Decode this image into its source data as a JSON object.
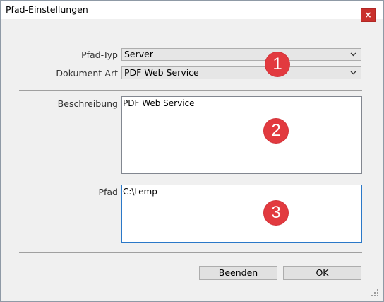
{
  "window": {
    "title": "Pfad-Einstellungen",
    "close_glyph": "×"
  },
  "form": {
    "pfad_typ": {
      "label": "Pfad-Typ",
      "value": "Server"
    },
    "dokument_art": {
      "label": "Dokument-Art",
      "value": "PDF Web Service"
    },
    "beschreibung": {
      "label": "Beschreibung",
      "value": "PDF Web Service"
    },
    "pfad": {
      "label": "Pfad",
      "value_before_caret": "C:\\t",
      "value_after_caret": "emp"
    }
  },
  "annotations": [
    "1",
    "2",
    "3"
  ],
  "buttons": {
    "beenden": "Beenden",
    "ok": "OK"
  },
  "colors": {
    "badge": "#e23a3f",
    "close": "#c9302c",
    "focus_border": "#2a78c8"
  }
}
